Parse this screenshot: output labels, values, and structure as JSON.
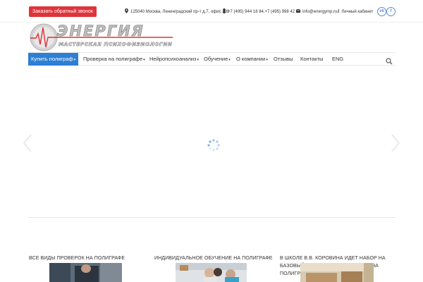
{
  "topbar": {
    "callback_label": "Заказать обратный звонок",
    "address": "125040 Москва, Ленинградский пр-т д.7, офис 238",
    "phones": "+7 (495) 944 18 84,+7 (495) 998 42 36",
    "email": "info@energymp.ru",
    "account": "Личный кабинет",
    "social_vk": "vk",
    "social_fb": "f"
  },
  "nav": {
    "items": [
      {
        "label": "Купить полиграф",
        "has_dropdown": true
      },
      {
        "label": "Проверка на полиграфе",
        "has_dropdown": true
      },
      {
        "label": "Нейропсихоанализ",
        "has_dropdown": true
      },
      {
        "label": "Обучение",
        "has_dropdown": true
      },
      {
        "label": "О компании",
        "has_dropdown": true
      },
      {
        "label": "Отзывы",
        "has_dropdown": false
      },
      {
        "label": "Контакты",
        "has_dropdown": false
      },
      {
        "label": "ENG",
        "has_dropdown": false
      }
    ]
  },
  "columns": [
    {
      "title": "ВСЕ ВИДЫ ПРОВЕРОК НА ПОЛИГРАФЕ"
    },
    {
      "title": "ИНДИВИДУАЛЬНОЕ ОБУЧЕНИЕ НА ПОЛИГРАФЕ"
    },
    {
      "title": "В ШКОЛЕ В.В. КОРОВИНА ИДЕТ НАБОР НА БАЗОВЫЙ КУРС ОБУЧЕНИЯ РАБОТЕ НА ПОЛИГРАФЕ"
    }
  ],
  "colors": {
    "accent_red": "#e0333a",
    "nav_active": "#2d7fd3",
    "social_blue": "#5b8fc7"
  }
}
